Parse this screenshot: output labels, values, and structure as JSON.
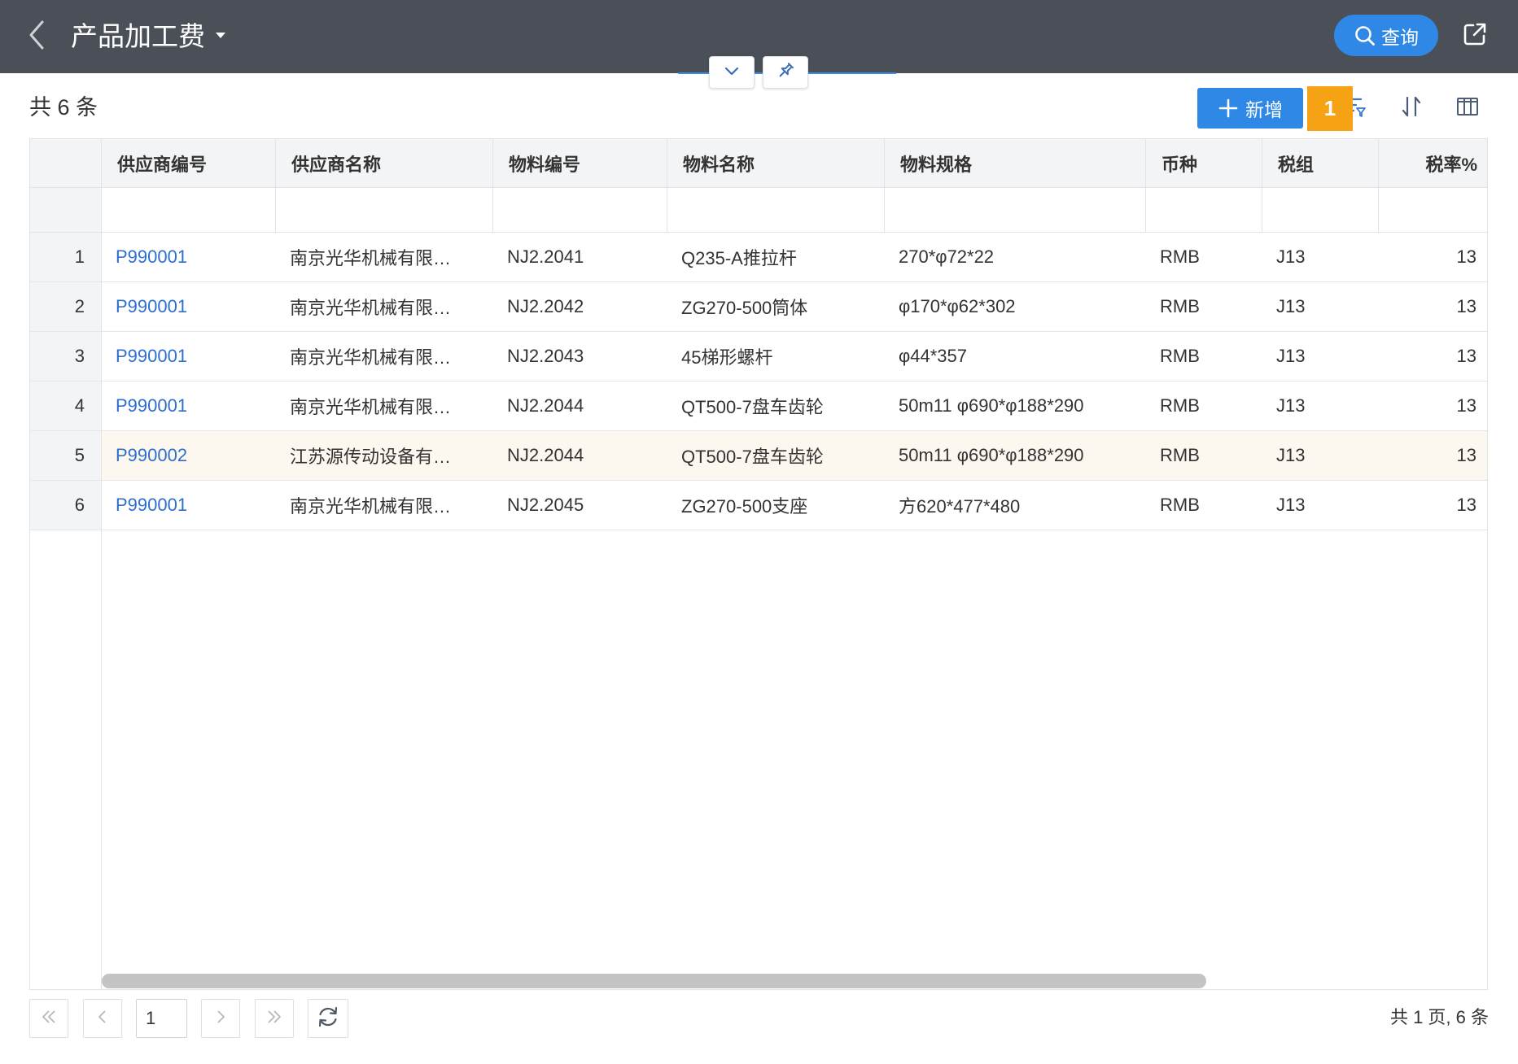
{
  "header": {
    "title": "产品加工费",
    "query_label": "查询"
  },
  "toolbar": {
    "count_text": "共 6 条",
    "add_label": "新增",
    "badge_count": "1"
  },
  "table": {
    "columns": [
      "供应商编号",
      "供应商名称",
      "物料编号",
      "物料名称",
      "物料规格",
      "币种",
      "税组",
      "税率%"
    ],
    "rows": [
      {
        "index": "1",
        "supplier_code": "P990001",
        "supplier_name": "南京光华机械有限…",
        "material_code": "NJ2.2041",
        "material_name": "Q235-A推拉杆",
        "material_spec": "270*φ72*22",
        "currency": "RMB",
        "tax_group": "J13",
        "tax_rate": "13"
      },
      {
        "index": "2",
        "supplier_code": "P990001",
        "supplier_name": "南京光华机械有限…",
        "material_code": "NJ2.2042",
        "material_name": "ZG270-500筒体",
        "material_spec": "φ170*φ62*302",
        "currency": "RMB",
        "tax_group": "J13",
        "tax_rate": "13"
      },
      {
        "index": "3",
        "supplier_code": "P990001",
        "supplier_name": "南京光华机械有限…",
        "material_code": "NJ2.2043",
        "material_name": "45梯形螺杆",
        "material_spec": "φ44*357",
        "currency": "RMB",
        "tax_group": "J13",
        "tax_rate": "13"
      },
      {
        "index": "4",
        "supplier_code": "P990001",
        "supplier_name": "南京光华机械有限…",
        "material_code": "NJ2.2044",
        "material_name": "QT500-7盘车齿轮",
        "material_spec": "50m11 φ690*φ188*290",
        "currency": "RMB",
        "tax_group": "J13",
        "tax_rate": "13"
      },
      {
        "index": "5",
        "supplier_code": "P990002",
        "supplier_name": "江苏源传动设备有…",
        "material_code": "NJ2.2044",
        "material_name": "QT500-7盘车齿轮",
        "material_spec": "50m11 φ690*φ188*290",
        "currency": "RMB",
        "tax_group": "J13",
        "tax_rate": "13"
      },
      {
        "index": "6",
        "supplier_code": "P990001",
        "supplier_name": "南京光华机械有限…",
        "material_code": "NJ2.2045",
        "material_name": "ZG270-500支座",
        "material_spec": "方620*477*480",
        "currency": "RMB",
        "tax_group": "J13",
        "tax_rate": "13"
      }
    ]
  },
  "pagination": {
    "current_page": "1",
    "summary": "共 1 页, 6 条"
  },
  "icons": {
    "back": "chevron-left-icon",
    "title_dropdown": "caret-down-icon",
    "query": "search-icon",
    "export": "external-link-icon",
    "collapse": "chevron-down-icon",
    "pin": "pin-icon",
    "add": "plus-icon",
    "filter": "filter-list-icon",
    "sort": "sort-icon",
    "columns": "columns-icon",
    "first_page": "first-page-icon",
    "prev_page": "prev-page-icon",
    "next_page": "next-page-icon",
    "last_page": "last-page-icon",
    "refresh": "refresh-icon"
  },
  "colors": {
    "topbar_bg": "#4b5058",
    "primary": "#2f88e6",
    "badge": "#f5a315",
    "link": "#2d6ecf",
    "header_bg": "#f3f4f6",
    "row_highlight": "#fdf8ef",
    "scrollbar": "#c4c4c4"
  }
}
